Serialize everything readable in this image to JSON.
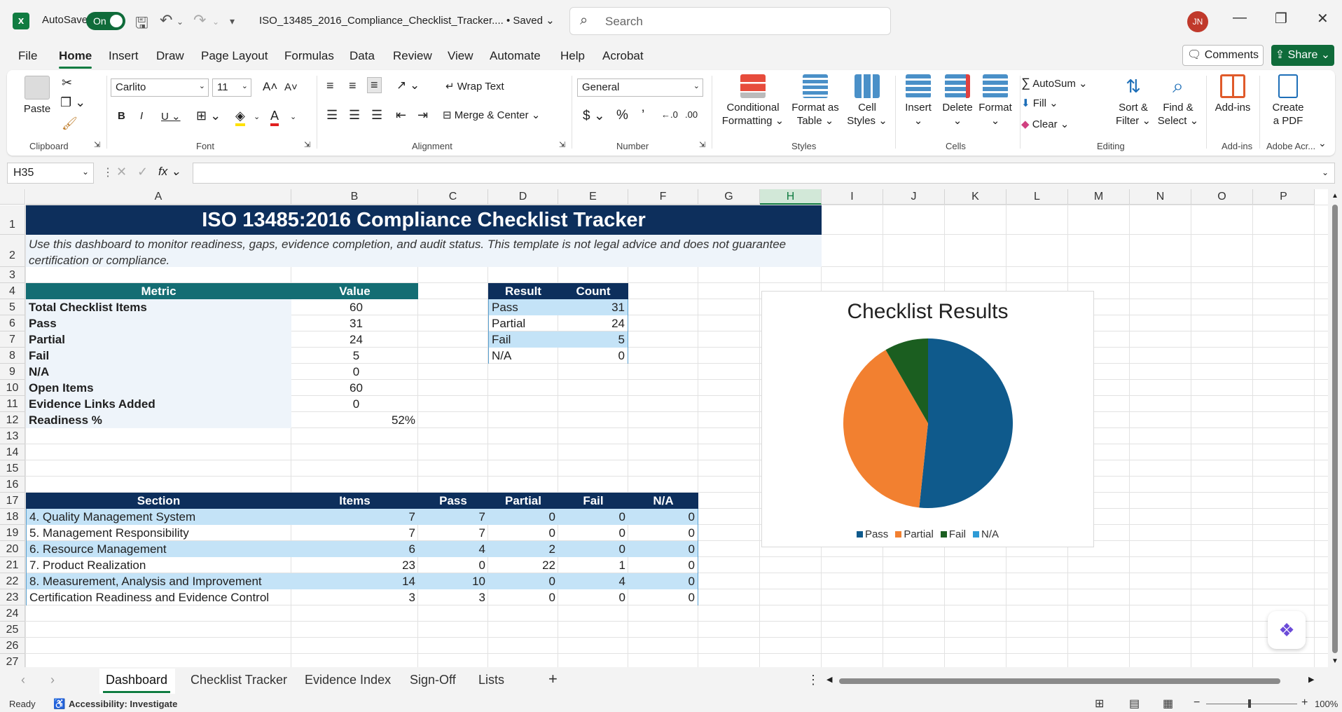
{
  "titlebar": {
    "autosave_label": "AutoSave",
    "autosave_state": "On",
    "file_name": "ISO_13485_2016_Compliance_Checklist_Tracker....",
    "save_state": "• Saved",
    "search_placeholder": "Search",
    "user_initials": "JN"
  },
  "menu": {
    "tabs": [
      "File",
      "Home",
      "Insert",
      "Draw",
      "Page Layout",
      "Formulas",
      "Data",
      "Review",
      "View",
      "Automate",
      "Help",
      "Acrobat"
    ],
    "active": "Home",
    "comments": "Comments",
    "share": "Share"
  },
  "ribbon": {
    "clipboard": {
      "paste": "Paste",
      "label": "Clipboard"
    },
    "font": {
      "name": "Carlito",
      "size": "11",
      "label": "Font"
    },
    "alignment": {
      "wrap": "Wrap Text",
      "merge": "Merge & Center",
      "label": "Alignment"
    },
    "number": {
      "format": "General",
      "label": "Number"
    },
    "styles": {
      "conditional": [
        "Conditional",
        "Formatting"
      ],
      "format_table": [
        "Format as",
        "Table"
      ],
      "cell_styles": [
        "Cell",
        "Styles"
      ],
      "label": "Styles"
    },
    "cells": {
      "insert": "Insert",
      "delete": "Delete",
      "format": "Format",
      "label": "Cells"
    },
    "editing": {
      "autosum": "AutoSum",
      "fill": "Fill",
      "clear": "Clear",
      "sort": [
        "Sort &",
        "Filter"
      ],
      "find": [
        "Find &",
        "Select"
      ],
      "label": "Editing"
    },
    "addins": {
      "btn": "Add-ins",
      "label": "Add-ins"
    },
    "adobe": {
      "btn": [
        "Create",
        "a PDF"
      ],
      "label": "Adobe Acr..."
    }
  },
  "formula_bar": {
    "name_box": "H35",
    "formula": ""
  },
  "columns": [
    "A",
    "B",
    "C",
    "D",
    "E",
    "F",
    "G",
    "H",
    "I",
    "J",
    "K",
    "L",
    "M",
    "N",
    "O",
    "P"
  ],
  "selected_column": "H",
  "rows": [
    "1",
    "2",
    "3",
    "4",
    "5",
    "6",
    "7",
    "8",
    "9",
    "10",
    "11",
    "12",
    "13",
    "14",
    "15",
    "16",
    "17",
    "18",
    "19",
    "20",
    "21",
    "22",
    "23",
    "24",
    "25",
    "26",
    "27"
  ],
  "sheet": {
    "title": "ISO 13485:2016 Compliance Checklist Tracker",
    "subtitle": "Use this dashboard to monitor readiness, gaps, evidence completion, and audit status. This template is not legal advice and does not guarantee certification or compliance.",
    "metrics": {
      "headers": [
        "Metric",
        "Value"
      ],
      "rows": [
        [
          "Total Checklist Items",
          "60"
        ],
        [
          "Pass",
          "31"
        ],
        [
          "Partial",
          "24"
        ],
        [
          "Fail",
          "5"
        ],
        [
          "N/A",
          "0"
        ],
        [
          "Open Items",
          "60"
        ],
        [
          "Evidence Links Added",
          "0"
        ],
        [
          "Readiness %",
          "52%"
        ]
      ]
    },
    "results": {
      "headers": [
        "Result",
        "Count"
      ],
      "rows": [
        [
          "Pass",
          "31"
        ],
        [
          "Partial",
          "24"
        ],
        [
          "Fail",
          "5"
        ],
        [
          "N/A",
          "0"
        ]
      ]
    },
    "sections": {
      "headers": [
        "Section",
        "Items",
        "Pass",
        "Partial",
        "Fail",
        "N/A"
      ],
      "rows": [
        [
          "4. Quality Management System",
          "7",
          "7",
          "0",
          "0",
          "0"
        ],
        [
          "5. Management Responsibility",
          "7",
          "7",
          "0",
          "0",
          "0"
        ],
        [
          "6. Resource Management",
          "6",
          "4",
          "2",
          "0",
          "0"
        ],
        [
          "7. Product Realization",
          "23",
          "0",
          "22",
          "1",
          "0"
        ],
        [
          "8. Measurement, Analysis and Improvement",
          "14",
          "10",
          "0",
          "4",
          "0"
        ],
        [
          "Certification Readiness and Evidence Control",
          "3",
          "3",
          "0",
          "0",
          "0"
        ]
      ]
    }
  },
  "chart_data": {
    "type": "pie",
    "title": "Checklist Results",
    "categories": [
      "Pass",
      "Partial",
      "Fail",
      "N/A"
    ],
    "values": [
      31,
      24,
      5,
      0
    ],
    "colors": [
      "#0f5a8c",
      "#f28030",
      "#1b5e20",
      "#2e9bd6"
    ],
    "legend": "bottom"
  },
  "sheet_tabs": [
    "Dashboard",
    "Checklist Tracker",
    "Evidence Index",
    "Sign-Off",
    "Lists"
  ],
  "active_sheet": "Dashboard",
  "status": {
    "ready": "Ready",
    "accessibility": "Accessibility: Investigate",
    "zoom": "100%"
  }
}
